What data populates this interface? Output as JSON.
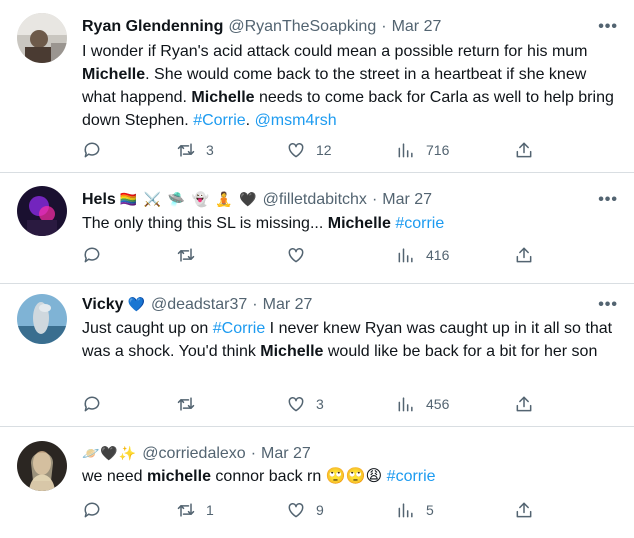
{
  "tweets": [
    {
      "name": "Ryan Glendenning",
      "emoji": "",
      "handle": "@RyanTheSoapking",
      "date": "Mar 27",
      "text_html": "I wonder if Ryan's acid attack could mean a possible return for his mum <b>Michelle</b>. She would come back to the street in a heartbeat if she knew what happend. <b>Michelle</b> needs to come back for Carla as well to help bring down Stephen. <span class=\"tag\">#Corrie</span>. <span class=\"tag\">@msm4rsh</span>",
      "replies": "",
      "retweets": "3",
      "likes": "12",
      "views": "716"
    },
    {
      "name": "Hels",
      "emoji": "🏳️‍🌈 ⚔️ 🛸 👻 🧘 🖤",
      "handle": "@filletdabitchx",
      "date": "Mar 27",
      "text_html": "The only thing this SL is missing... <b>Michelle</b> <span class=\"tag\">#corrie</span>",
      "replies": "",
      "retweets": "",
      "likes": "",
      "views": "416"
    },
    {
      "name": "Vicky",
      "emoji": "💙",
      "handle": "@deadstar37",
      "date": "Mar 27",
      "text_html": "Just caught up on <span class=\"tag\">#Corrie</span> I never knew Ryan was caught up in it all so that was a shock. You'd think <b>Michelle</b> would like be back for a bit for her son",
      "replies": "",
      "retweets": "",
      "likes": "3",
      "views": "456"
    },
    {
      "name": "",
      "emoji": "🪐🖤✨",
      "handle": "@corriedalexo",
      "date": "Mar 27",
      "text_html": "we need <b>michelle</b> connor back rn 🙄🙄😩 <span class=\"tag\">#corrie</span>",
      "replies": "",
      "retweets": "1",
      "likes": "9",
      "views": "5"
    }
  ],
  "more_label": "•••",
  "dot": "·",
  "colors": {
    "link": "#1d9bf0",
    "muted": "#536471",
    "text": "#0f1419",
    "divider": "#d9dee2"
  }
}
